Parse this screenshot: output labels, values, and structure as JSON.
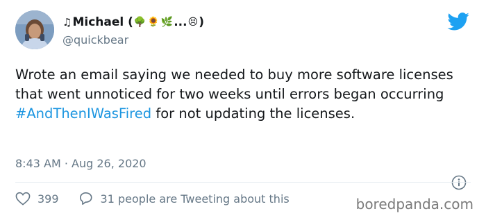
{
  "tweet": {
    "display_name_prefix": "♫",
    "display_name": "Michael (",
    "emoji_1": "🌳",
    "emoji_2": "🌻",
    "emoji_3": "🌿",
    "ellipsis": "...",
    "emoji_4": "😣",
    "display_name_suffix": ")",
    "handle": "@quickbear",
    "text_before": "Wrote an email saying we needed to buy more software licenses that went unnoticed for two weeks until errors began occurring ",
    "hashtag": "#AndThenIWasFired",
    "text_after": " for not updating the licenses.",
    "timestamp": "8:43 AM · Aug 26, 2020",
    "like_count": "399",
    "reply_text": "31 people are Tweeting about this"
  },
  "watermark": "boredpanda.com",
  "colors": {
    "text": "#14171a",
    "secondary": "#657786",
    "link": "#1b95e0",
    "twitter_blue": "#1da1f2"
  },
  "icons": [
    "twitter-bird-icon",
    "info-icon",
    "heart-icon",
    "reply-icon"
  ]
}
